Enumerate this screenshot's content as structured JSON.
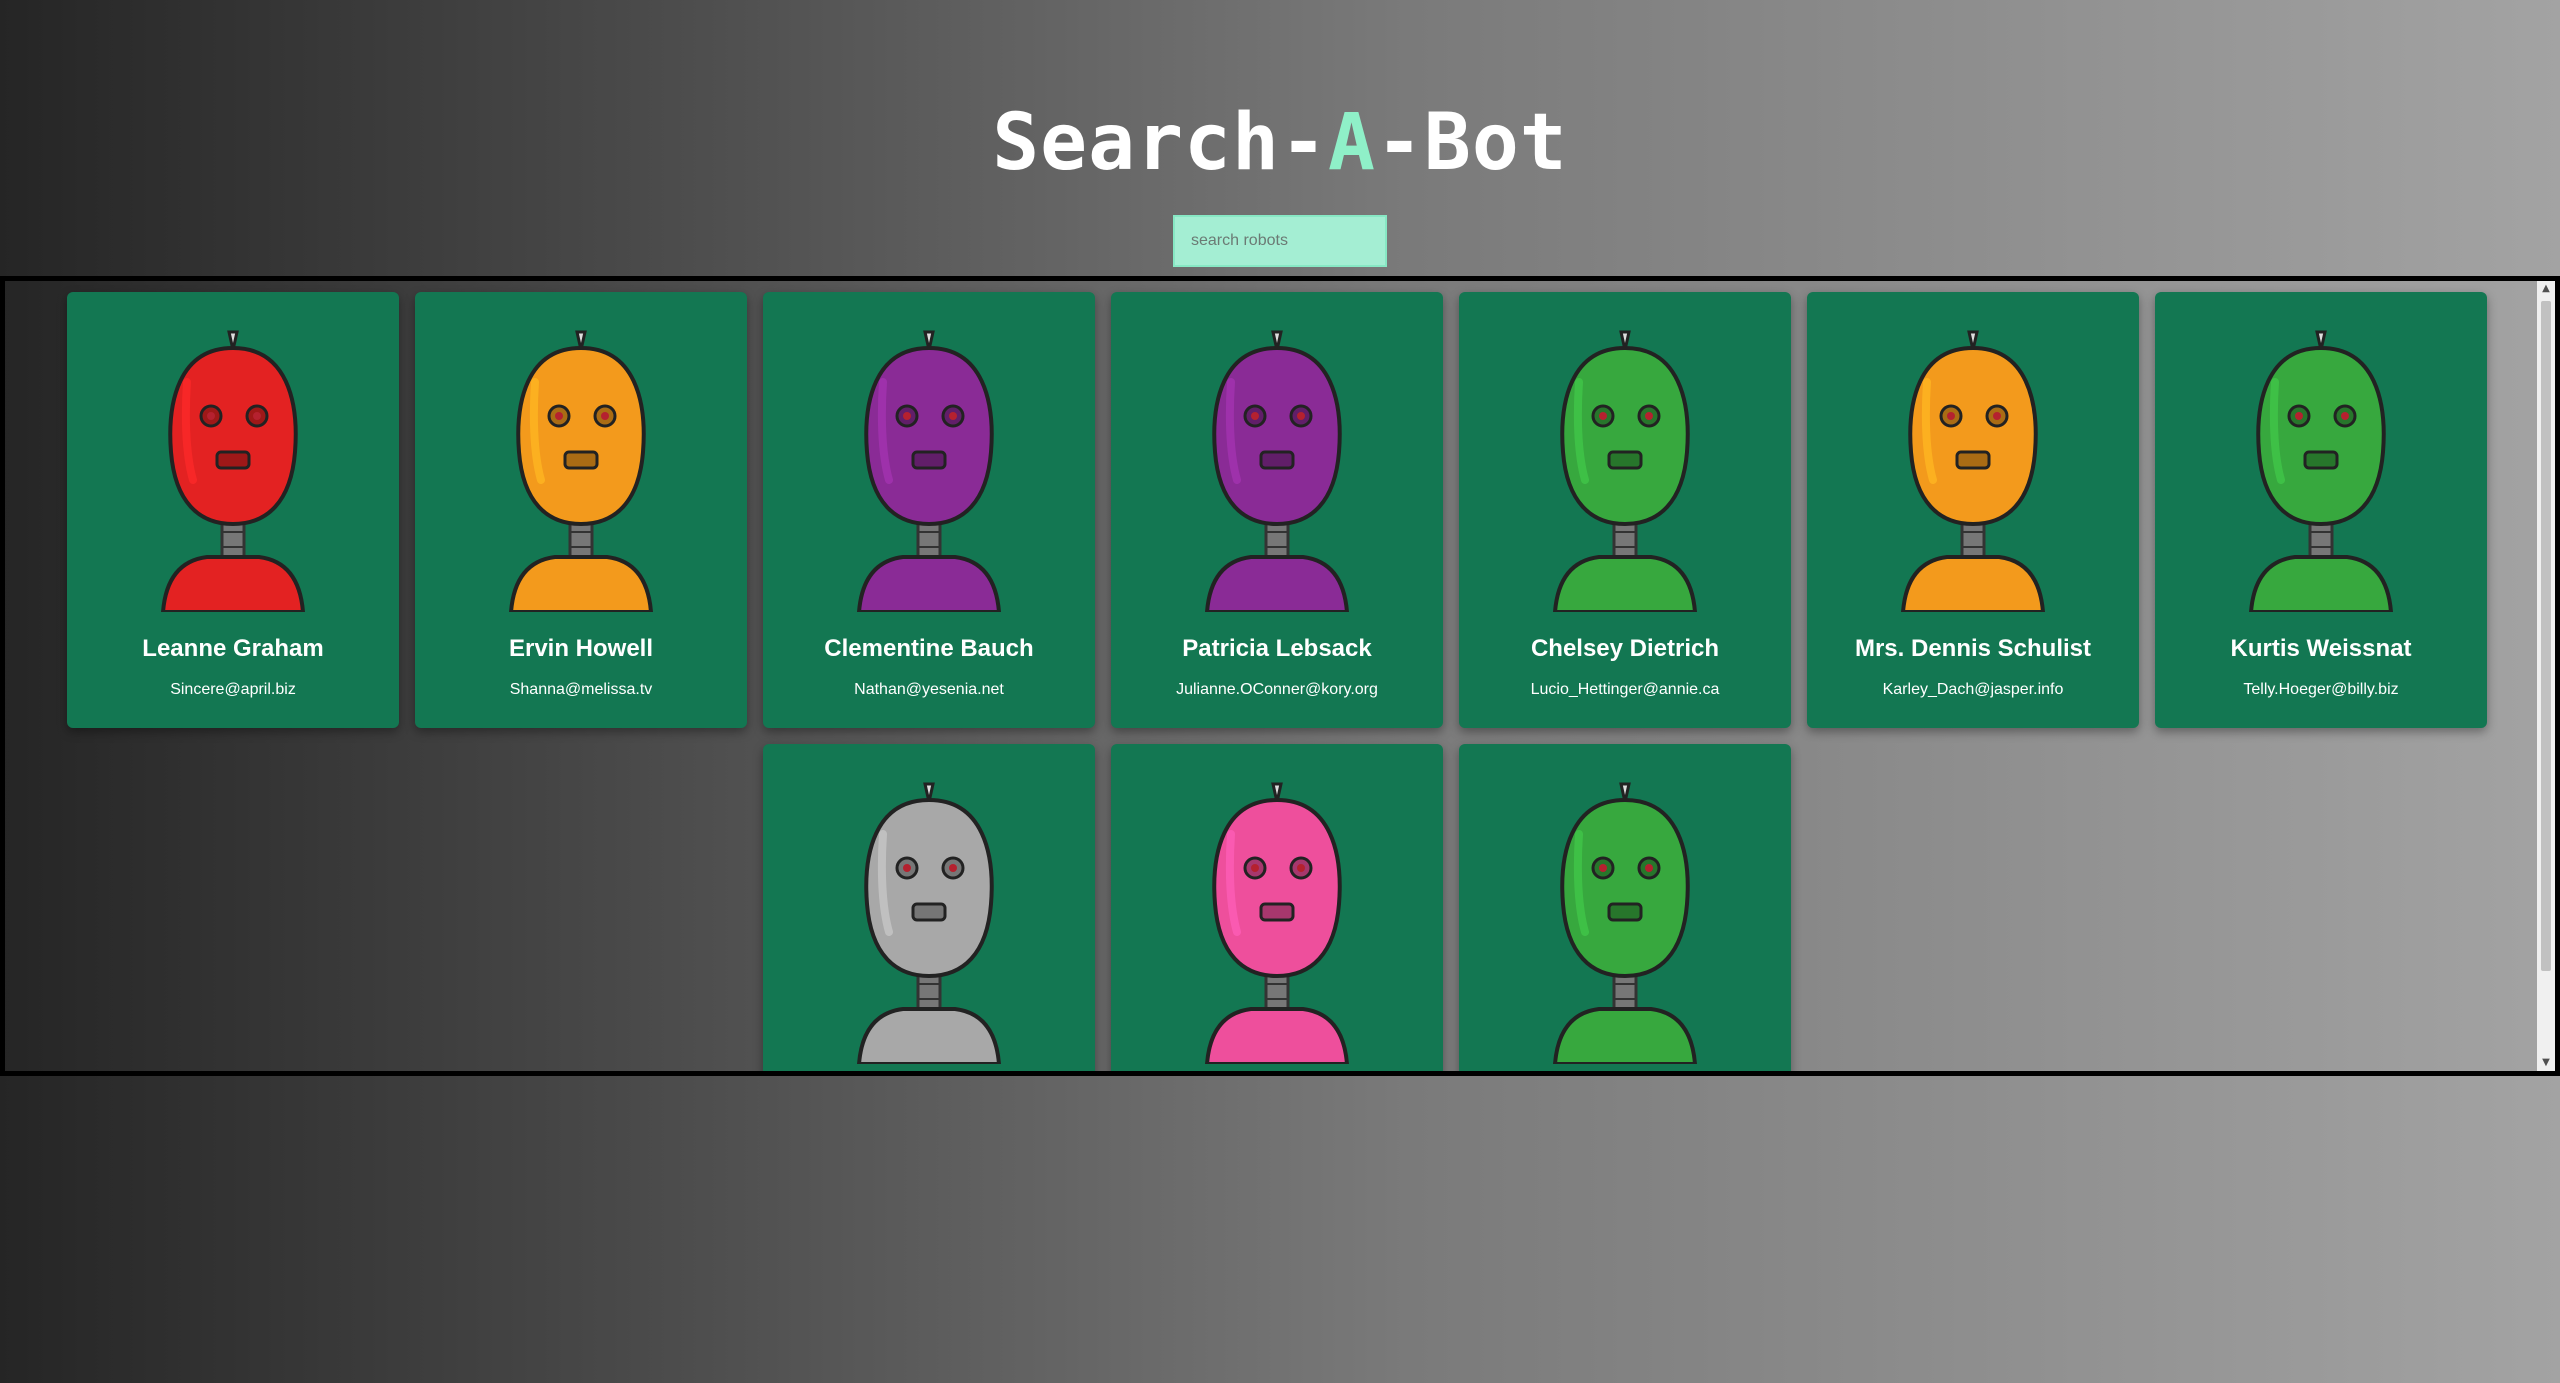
{
  "header": {
    "title_prefix": "Search-",
    "title_accent": "A",
    "title_suffix": "-Bot",
    "accent_color": "#8ff0c8"
  },
  "search": {
    "placeholder": "search robots",
    "value": ""
  },
  "card_color": "#137752",
  "robots": [
    {
      "name": "Leanne Graham",
      "email": "Sincere@april.biz",
      "color": "#e32222",
      "icon": "red-robot-avatar"
    },
    {
      "name": "Ervin Howell",
      "email": "Shanna@melissa.tv",
      "color": "#f39a1c",
      "icon": "orange-robot-avatar"
    },
    {
      "name": "Clementine Bauch",
      "email": "Nathan@yesenia.net",
      "color": "#8a2b96",
      "icon": "purple-robot-avatar"
    },
    {
      "name": "Patricia Lebsack",
      "email": "Julianne.OConner@kory.org",
      "color": "#8a2b96",
      "icon": "purple-robot-avatar"
    },
    {
      "name": "Chelsey Dietrich",
      "email": "Lucio_Hettinger@annie.ca",
      "color": "#37a83e",
      "icon": "green-robot-avatar"
    },
    {
      "name": "Mrs. Dennis Schulist",
      "email": "Karley_Dach@jasper.info",
      "color": "#f39a1c",
      "icon": "orange-robot-avatar"
    },
    {
      "name": "Kurtis Weissnat",
      "email": "Telly.Hoeger@billy.biz",
      "color": "#37a83e",
      "icon": "green-robot-avatar"
    },
    {
      "name": "",
      "email": "",
      "color": "#a8a8a8",
      "icon": "grey-robot-avatar"
    },
    {
      "name": "",
      "email": "",
      "color": "#ee4f9c",
      "icon": "pink-robot-avatar"
    },
    {
      "name": "",
      "email": "",
      "color": "#37a83e",
      "icon": "green-robot-avatar"
    }
  ]
}
